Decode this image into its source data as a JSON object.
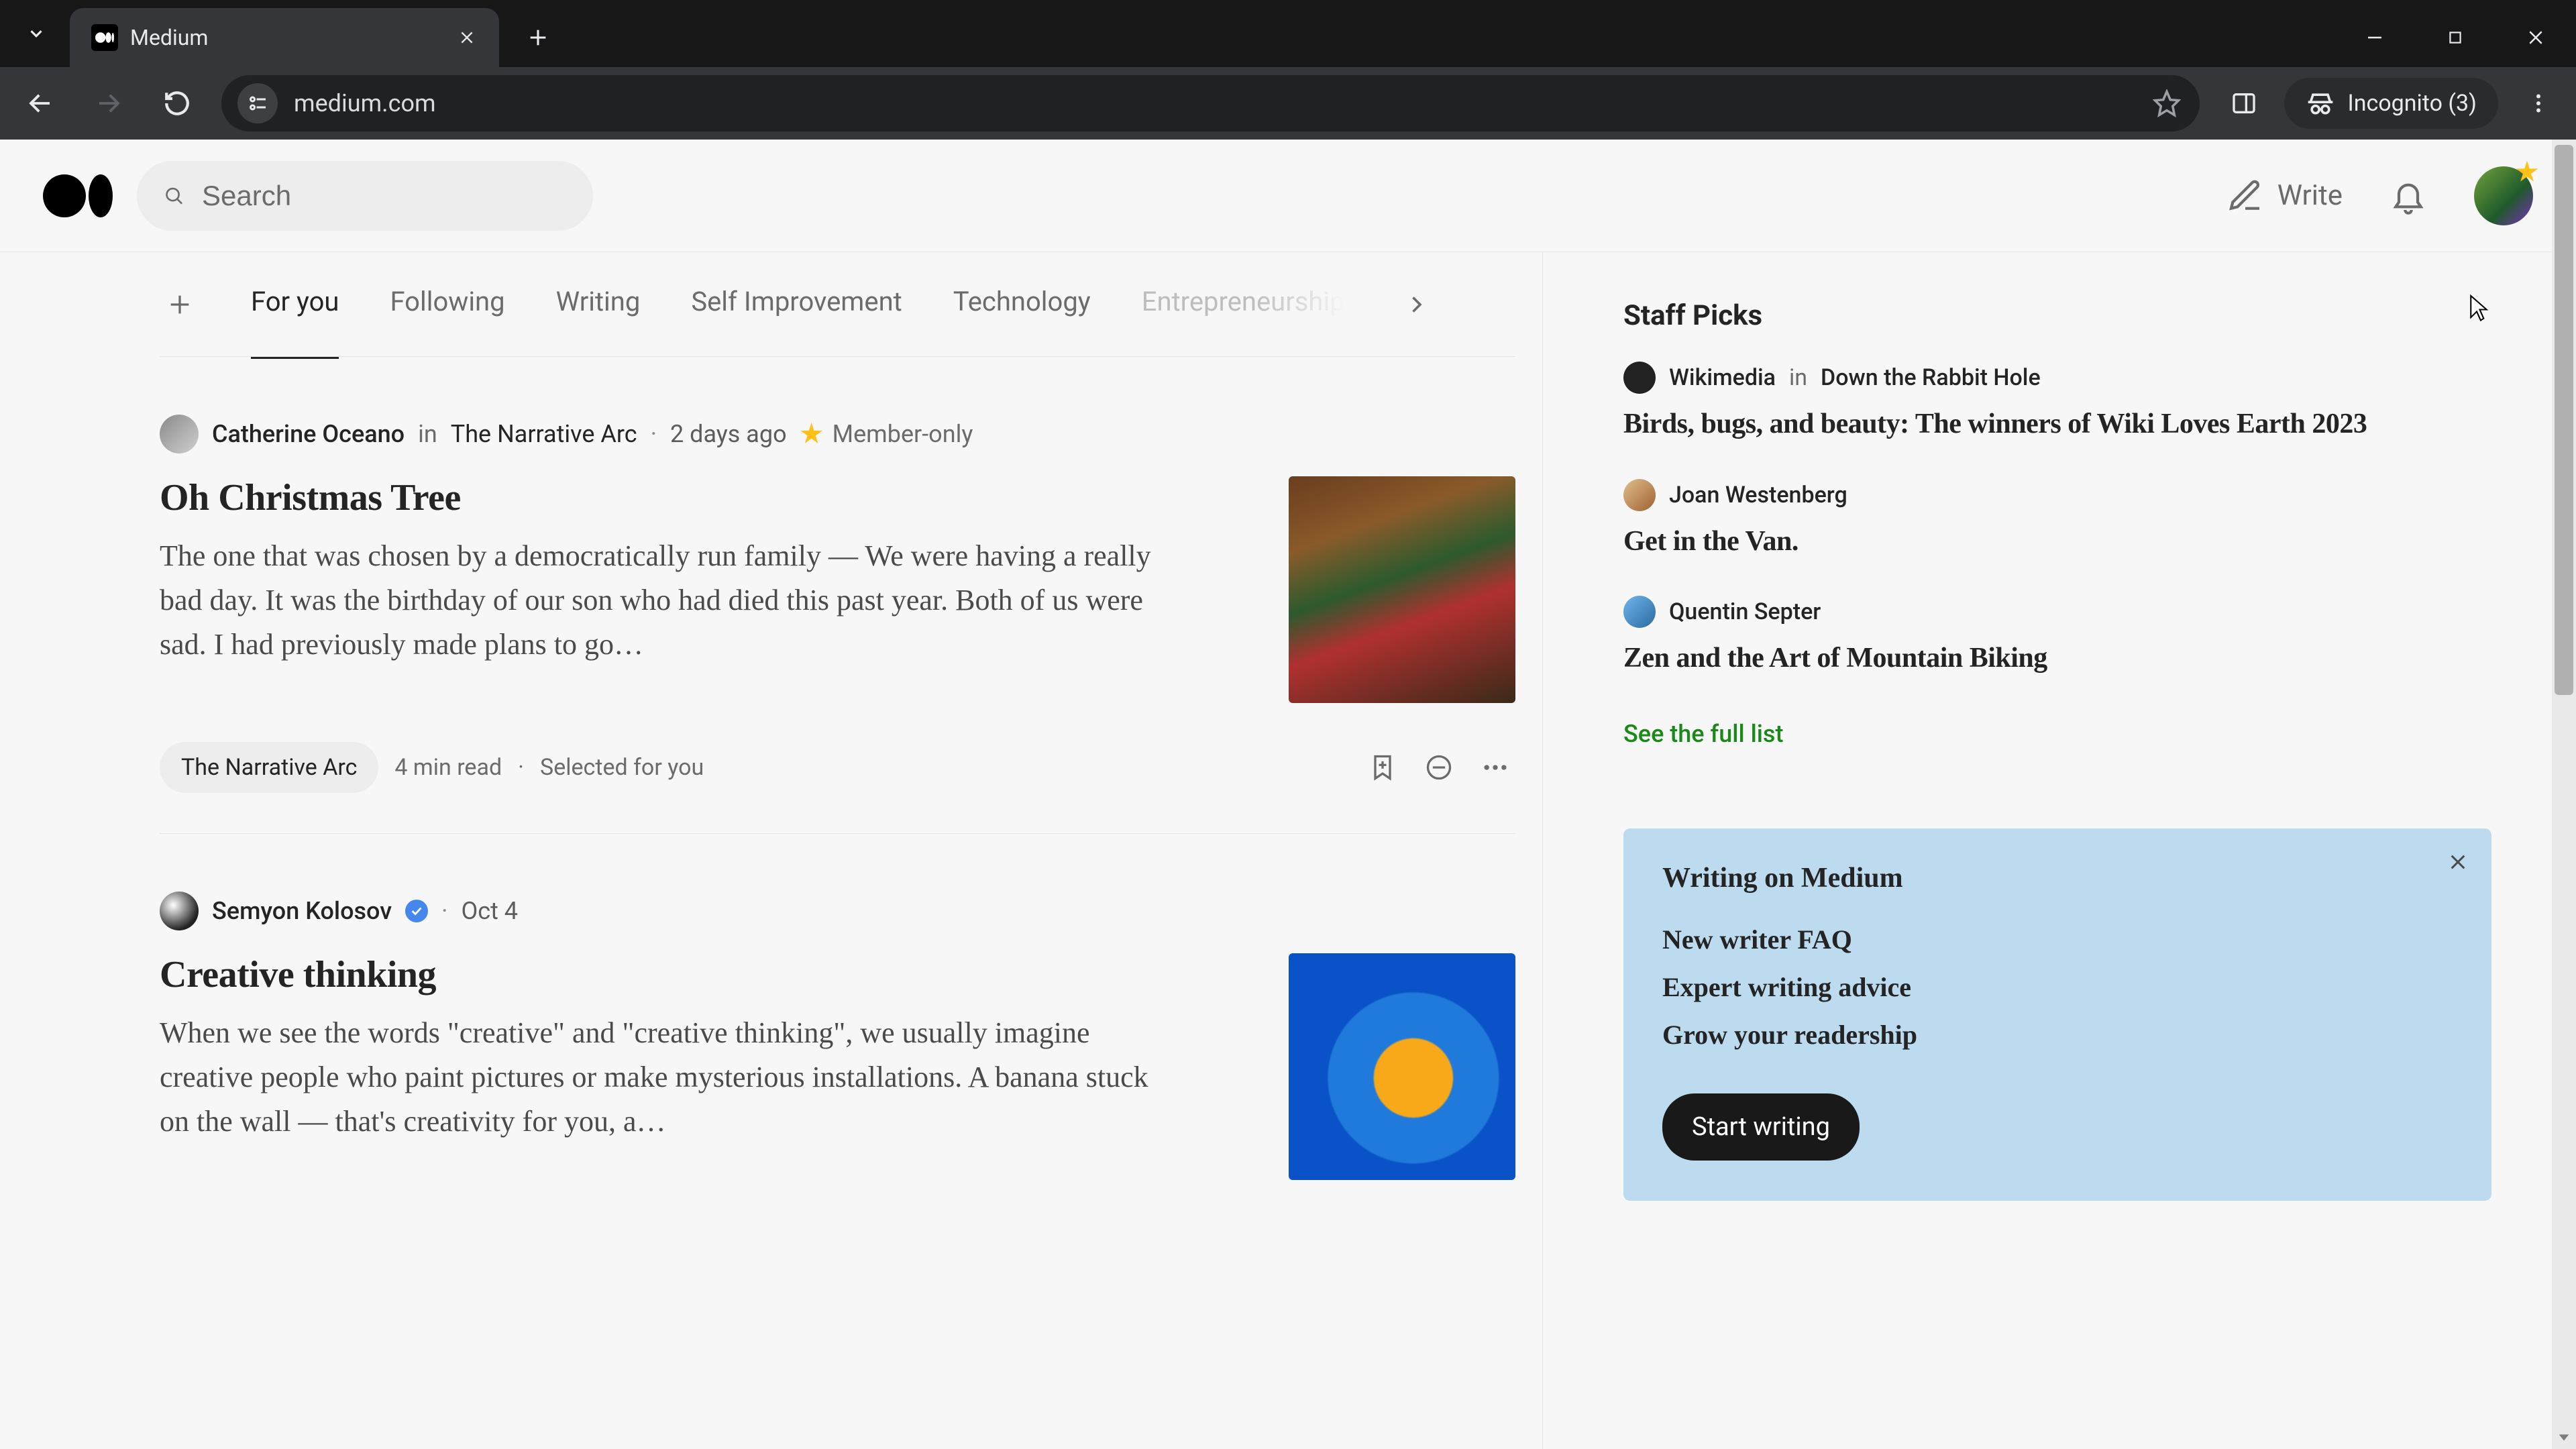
{
  "browser": {
    "tab_title": "Medium",
    "url": "medium.com",
    "incognito_label": "Incognito (3)"
  },
  "header": {
    "search_placeholder": "Search",
    "write_label": "Write"
  },
  "feed_tabs": {
    "items": [
      "For you",
      "Following",
      "Writing",
      "Self Improvement",
      "Technology",
      "Entrepreneurship"
    ],
    "active_index": 0
  },
  "articles": [
    {
      "author": "Catherine Oceano",
      "in_word": "in",
      "publication": "The Narrative Arc",
      "date": "2 days ago",
      "member_only": "Member-only",
      "title": "Oh Christmas Tree",
      "excerpt": "The one that was chosen by a democratically run family — We were having a really bad day. It was the birthday of our son who had died this past year. Both of us were sad. I had previously made plans to go…",
      "collection_chip": "The Narrative Arc",
      "read_time": "4 min read",
      "reason": "Selected for you"
    },
    {
      "author": "Semyon Kolosov",
      "verified": true,
      "date": "Oct 4",
      "title": "Creative thinking",
      "excerpt": "When we see the words \"creative\" and \"creative thinking\", we usually imagine creative people who paint pictures or make mysterious installations. A banana stuck on the wall — that's creativity for you, a…"
    }
  ],
  "sidebar": {
    "staff_picks_heading": "Staff Picks",
    "staff_picks": [
      {
        "author": "Wikimedia",
        "in_word": "in",
        "publication": "Down the Rabbit Hole",
        "title": "Birds, bugs, and beauty: The winners of Wiki Loves Earth 2023"
      },
      {
        "author": "Joan Westenberg",
        "title": "Get in the Van."
      },
      {
        "author": "Quentin Septer",
        "title": "Zen and the Art of Mountain Biking"
      }
    ],
    "see_full_list": "See the full list",
    "promo": {
      "heading": "Writing on Medium",
      "links": [
        "New writer FAQ",
        "Expert writing advice",
        "Grow your readership"
      ],
      "button": "Start writing"
    }
  }
}
